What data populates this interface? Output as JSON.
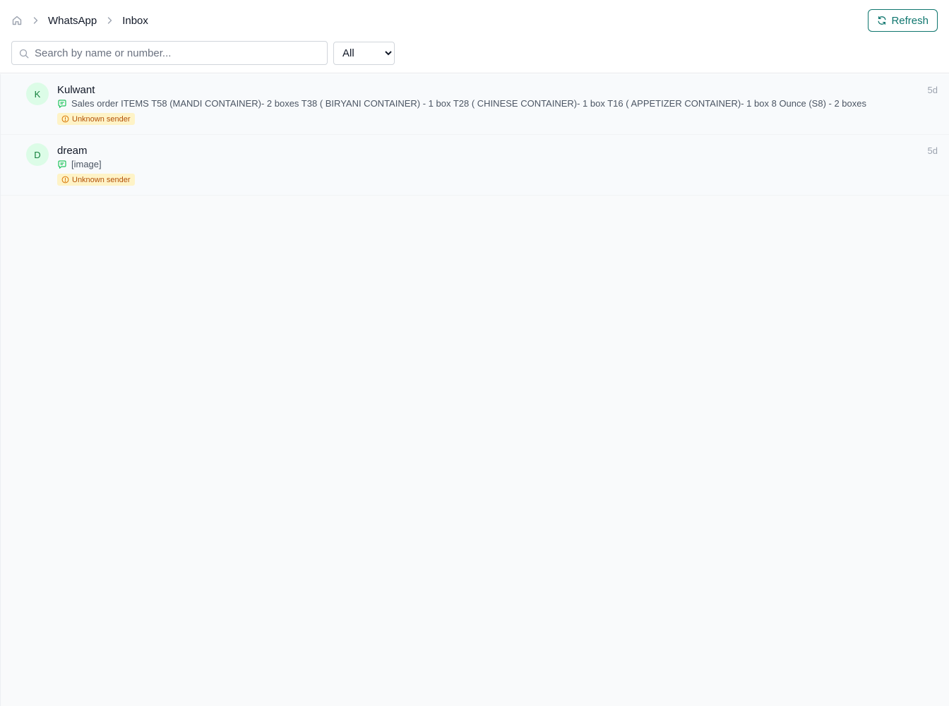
{
  "breadcrumb": {
    "home_icon": "home-icon",
    "items": [
      "WhatsApp",
      "Inbox"
    ]
  },
  "toolbar": {
    "refresh_label": "Refresh",
    "refresh_icon": "refresh-icon",
    "accent_color": "#0f766e"
  },
  "search": {
    "placeholder": "Search by name or number...",
    "value": ""
  },
  "filter": {
    "selected": "All"
  },
  "conversations": [
    {
      "avatar_letter": "K",
      "name": "Kulwant",
      "time": "5d",
      "preview": "Sales order ITEMS T58 (MANDI CONTAINER)- 2 boxes T38 ( BIRYANI CONTAINER) - 1 box T28 ( CHINESE CONTAINER)- 1 box T16 ( APPETIZER CONTAINER)- 1 box 8 Ounce (S8) - 2 boxes",
      "badge": "Unknown sender"
    },
    {
      "avatar_letter": "D",
      "name": "dream",
      "time": "5d",
      "preview": "[image]",
      "badge": "Unknown sender"
    }
  ],
  "colors": {
    "avatar_bg": "#dcfce7",
    "avatar_fg": "#15803d",
    "badge_bg": "#fef3c7",
    "badge_fg": "#b45309"
  }
}
